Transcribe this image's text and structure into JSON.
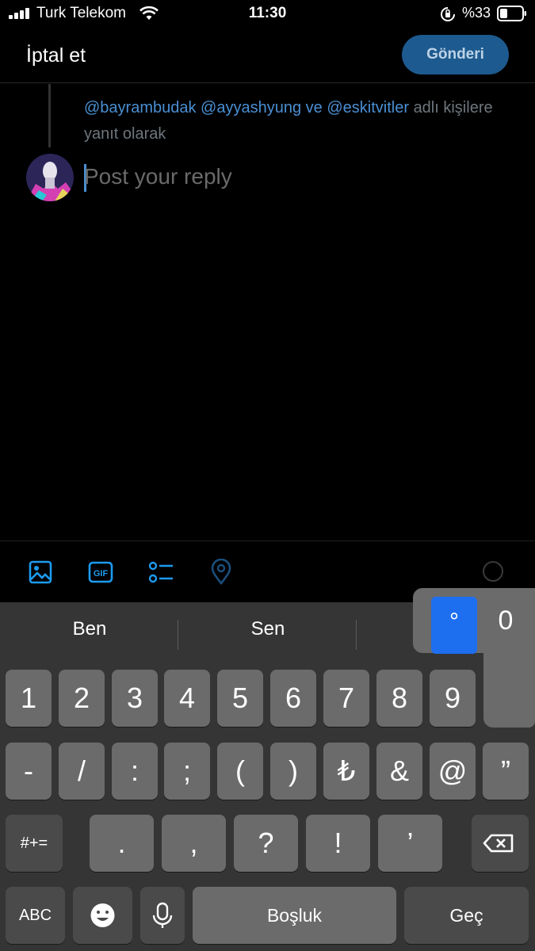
{
  "status_bar": {
    "carrier": "Turk Telekom",
    "time": "11:30",
    "battery": "%33"
  },
  "header": {
    "cancel_label": "İptal et",
    "send_label": "Gönderi"
  },
  "reply_context": {
    "mention_1": "@bayrambudak",
    "mention_2": "@ayyashyung",
    "connector": "ve",
    "mention_3": "@eskitvitler",
    "suffix": "adlı kişilere yanıt olarak"
  },
  "composer": {
    "placeholder": "Post your reply"
  },
  "toolbar": {
    "icons": [
      "image-icon",
      "gif-icon",
      "poll-icon",
      "location-icon"
    ],
    "gif_text": "GIF"
  },
  "keyboard": {
    "suggestions": [
      "Ben",
      "Sen"
    ],
    "popup_selected": "°",
    "popup_alt": "0",
    "row1": [
      "1",
      "2",
      "3",
      "4",
      "5",
      "6",
      "7",
      "8",
      "9"
    ],
    "row2": [
      "-",
      "/",
      ":",
      ";",
      "(",
      ")",
      "₺",
      "&",
      "@",
      "”"
    ],
    "row3_mode": "#+=",
    "row3": [
      ".",
      ",",
      "?",
      "!",
      "’"
    ],
    "abc": "ABC",
    "space": "Boşluk",
    "return": "Geç"
  },
  "colors": {
    "accent": "#1d9bf0",
    "mention": "#4a8fd3",
    "send_bg": "#1d5a8f",
    "key_bg": "#6b6b6b",
    "keyboard_bg": "#353535"
  }
}
